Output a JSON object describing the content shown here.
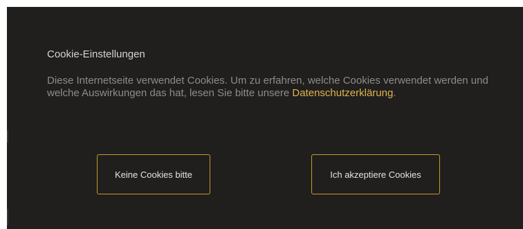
{
  "cookie_dialog": {
    "title": "Cookie-Einstellungen",
    "body_text": "Diese Internetseite verwendet Cookies. Um zu erfahren, welche Cookies verwendet werden und welche Auswirkungen das hat, lesen Sie bitte unsere ",
    "privacy_link": "Datenschutzerklärung",
    "body_suffix": ".",
    "decline_label": "Keine Cookies bitte",
    "accept_label": "Ich akzeptiere Cookies"
  },
  "colors": {
    "background": "#201f1e",
    "accent": "#c79a2c",
    "link": "#e2b34a",
    "title_text": "#d6d3cf",
    "body_text": "#8f8c88"
  }
}
